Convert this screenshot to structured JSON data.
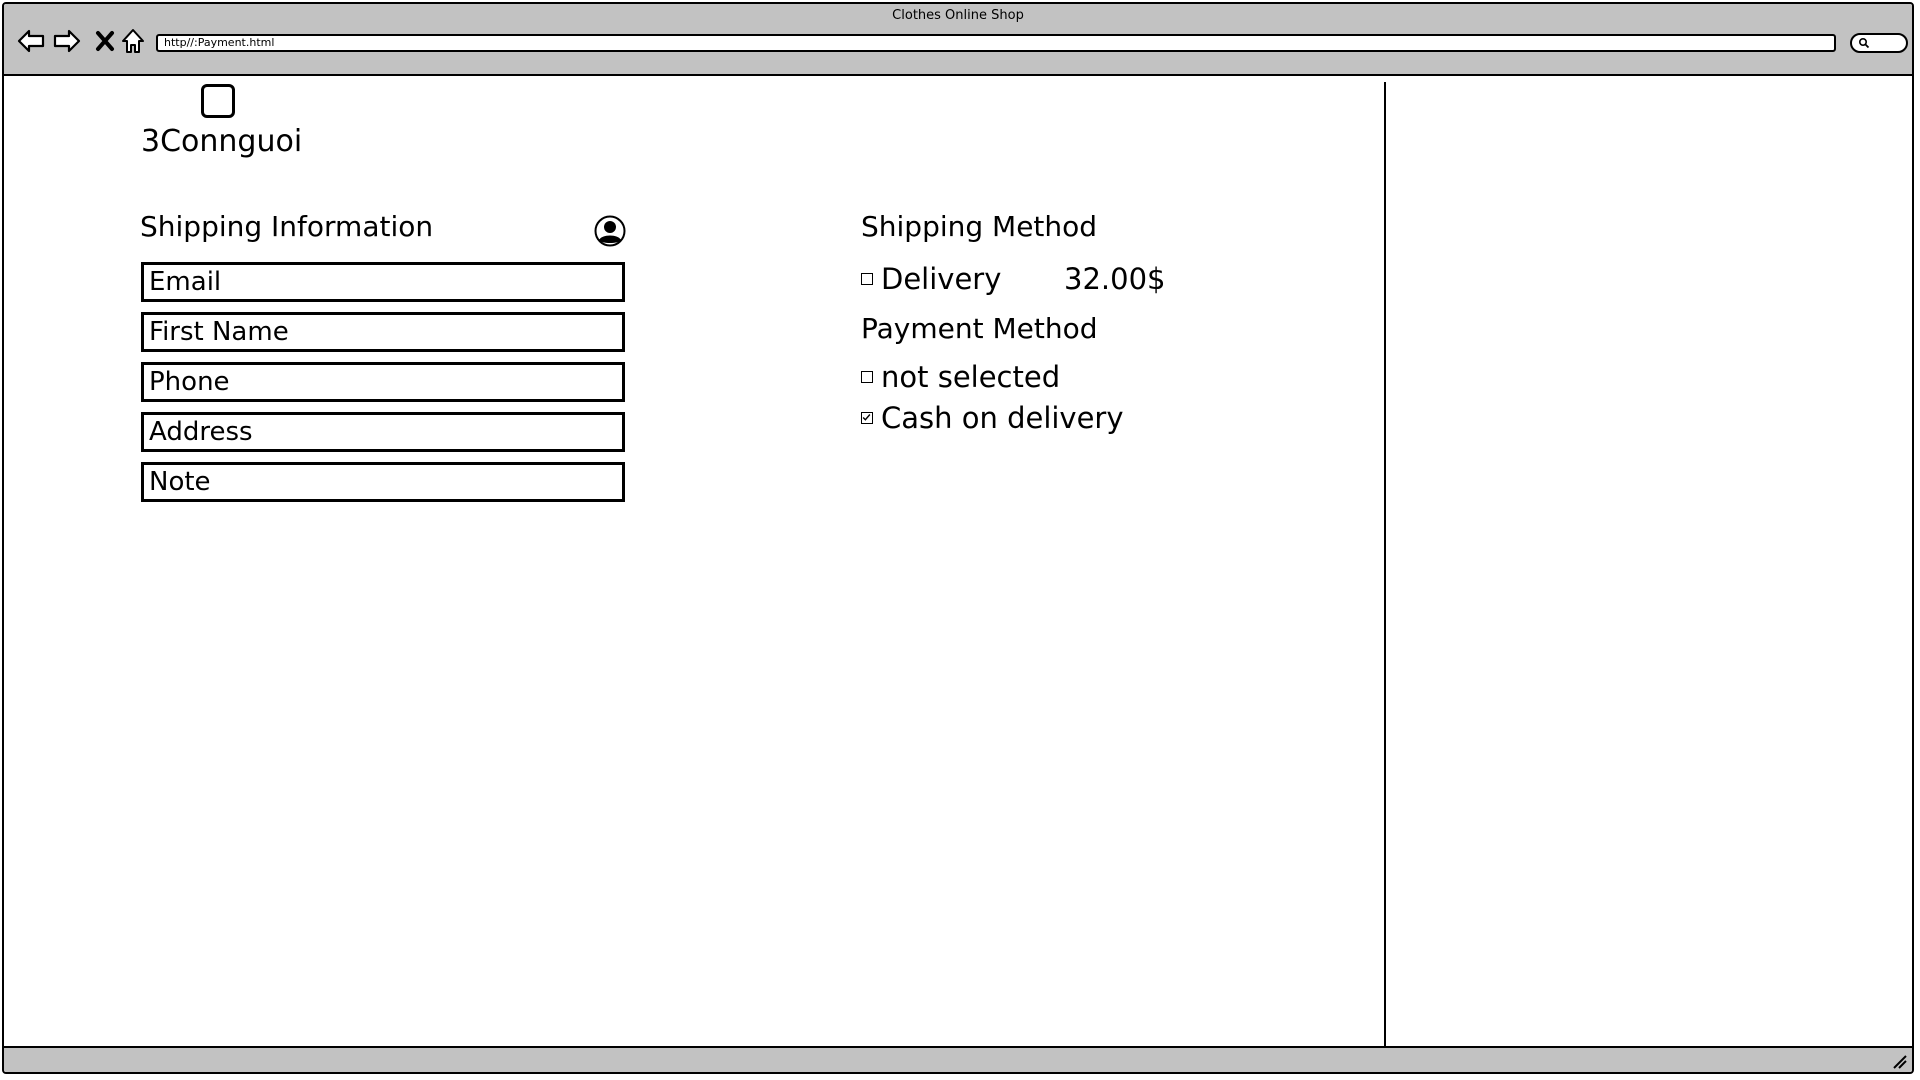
{
  "browser": {
    "title": "Clothes Online Shop",
    "url": "http//:Payment.html"
  },
  "brand": {
    "name": "3Connguoi"
  },
  "shipping_info": {
    "title": "Shipping Information",
    "fields": {
      "email": "Email",
      "first_name": "First Name",
      "phone": "Phone",
      "address": "Address",
      "note": "Note"
    }
  },
  "shipping_method": {
    "title": "Shipping Method",
    "delivery_label": "Delivery",
    "delivery_price": "32.00$",
    "delivery_checked": false
  },
  "payment_method": {
    "title": "Payment Method",
    "options": [
      {
        "label": "not selected",
        "checked": false
      },
      {
        "label": "Cash on delivery",
        "checked": true
      }
    ]
  },
  "icons": [
    "back-arrow-icon",
    "forward-arrow-icon",
    "stop-icon",
    "home-icon",
    "search-icon",
    "user-icon",
    "resize-grip-icon"
  ]
}
